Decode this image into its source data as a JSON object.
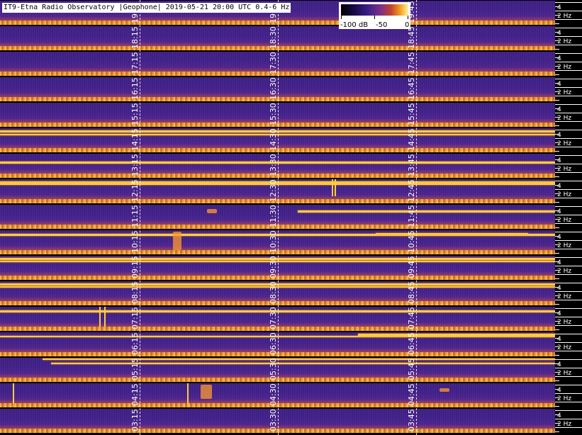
{
  "title": "IT9-Etna Radio Observatory |Geophone| 2019-05-21 20:00 UTC 0.4-6 Hz",
  "colorbar": {
    "label_min": "-100 dB",
    "label_mid": "-50",
    "label_max": "0",
    "colors": [
      "#000000",
      "#3a1f86",
      "#7a2f8a",
      "#c0402e",
      "#f0a020",
      "#fff4a0"
    ]
  },
  "freq_axis": {
    "upper_label": "4",
    "lower_label": "2 Hz"
  },
  "rows": [
    {
      "labels": [
        "19:",
        "19:",
        "19:45"
      ]
    },
    {
      "labels": [
        "18:15",
        "18:30",
        "18:45"
      ]
    },
    {
      "labels": [
        "17:15",
        "17:30",
        "17:45"
      ]
    },
    {
      "labels": [
        "16:15",
        "16:30",
        "16:45"
      ]
    },
    {
      "labels": [
        "15:15",
        "15:30",
        "15:45"
      ]
    },
    {
      "labels": [
        "14:15",
        "14:30",
        "14:45"
      ]
    },
    {
      "labels": [
        "13:15",
        "13:30",
        "13:45"
      ]
    },
    {
      "labels": [
        "12:15",
        "12:30",
        "12:45"
      ]
    },
    {
      "labels": [
        "11:15",
        "11:30",
        "11:45"
      ]
    },
    {
      "labels": [
        "10:15",
        "10:30",
        "10:45"
      ]
    },
    {
      "labels": [
        "09:15",
        "09:30",
        "09:45"
      ]
    },
    {
      "labels": [
        "08:15",
        "08:30",
        "08:45"
      ]
    },
    {
      "labels": [
        "07:15",
        "07:30",
        "07:45"
      ]
    },
    {
      "labels": [
        "06:15",
        "06:30",
        "06:45"
      ]
    },
    {
      "labels": [
        "05:15",
        "05:30",
        "05:45"
      ]
    },
    {
      "labels": [
        "04:15",
        "04:30",
        "04:45"
      ]
    },
    {
      "labels": [
        "03:15",
        "03:30",
        "03:45"
      ]
    }
  ]
}
